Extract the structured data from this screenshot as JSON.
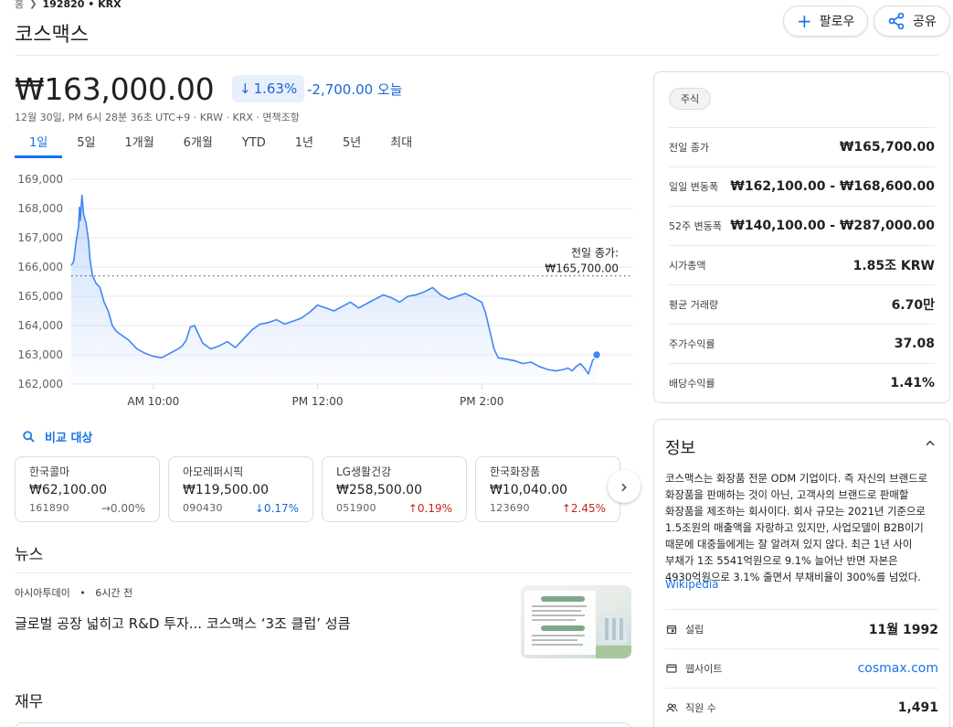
{
  "breadcrumb": {
    "home": "홈",
    "ticker": "192820 • KRX"
  },
  "title": "코스맥스",
  "actions": {
    "follow": "팔로우",
    "share": "공유"
  },
  "quote": {
    "price": "₩163,000.00",
    "change_pct": "1.63%",
    "change_abs": "-2,700.00 오늘",
    "meta": "12월 30일, PM 6시 28분 36초 UTC+9 · KRW · KRX · 면책조항"
  },
  "ranges": [
    "1일",
    "5일",
    "1개월",
    "6개월",
    "YTD",
    "1년",
    "5년",
    "최대"
  ],
  "active_range": "1일",
  "chart_data": {
    "type": "line",
    "y_ticks": [
      "169,000",
      "168,000",
      "167,000",
      "166,000",
      "165,000",
      "164,000",
      "163,000",
      "162,000"
    ],
    "x_ticks": [
      "AM 10:00",
      "PM 12:00",
      "PM 2:00"
    ],
    "ylim": [
      162000,
      169000
    ],
    "x_range_hours": [
      9.0,
      15.5
    ],
    "prev_close": 165700,
    "prev_close_label": [
      "전일 종가:",
      "₩165,700.00"
    ],
    "line_color": "#4285f4",
    "points": [
      [
        9.0,
        166050
      ],
      [
        9.03,
        166200
      ],
      [
        9.06,
        166900
      ],
      [
        9.09,
        167400
      ],
      [
        9.1,
        168050
      ],
      [
        9.11,
        167600
      ],
      [
        9.13,
        168450
      ],
      [
        9.15,
        167800
      ],
      [
        9.18,
        167500
      ],
      [
        9.21,
        166900
      ],
      [
        9.23,
        166200
      ],
      [
        9.26,
        165700
      ],
      [
        9.3,
        165450
      ],
      [
        9.35,
        165300
      ],
      [
        9.4,
        164800
      ],
      [
        9.45,
        164500
      ],
      [
        9.5,
        164000
      ],
      [
        9.55,
        163800
      ],
      [
        9.6,
        163700
      ],
      [
        9.7,
        163500
      ],
      [
        9.8,
        163200
      ],
      [
        9.9,
        163050
      ],
      [
        10.0,
        162950
      ],
      [
        10.1,
        162900
      ],
      [
        10.2,
        163050
      ],
      [
        10.3,
        163200
      ],
      [
        10.35,
        163300
      ],
      [
        10.4,
        163500
      ],
      [
        10.45,
        163950
      ],
      [
        10.5,
        164000
      ],
      [
        10.55,
        163700
      ],
      [
        10.6,
        163400
      ],
      [
        10.7,
        163200
      ],
      [
        10.8,
        163300
      ],
      [
        10.9,
        163450
      ],
      [
        11.0,
        163250
      ],
      [
        11.1,
        163550
      ],
      [
        11.2,
        163850
      ],
      [
        11.3,
        164050
      ],
      [
        11.4,
        164100
      ],
      [
        11.5,
        164200
      ],
      [
        11.6,
        164050
      ],
      [
        11.7,
        164150
      ],
      [
        11.8,
        164250
      ],
      [
        11.9,
        164450
      ],
      [
        12.0,
        164700
      ],
      [
        12.1,
        164600
      ],
      [
        12.2,
        164500
      ],
      [
        12.3,
        164650
      ],
      [
        12.4,
        164800
      ],
      [
        12.5,
        164600
      ],
      [
        12.6,
        164750
      ],
      [
        12.7,
        164900
      ],
      [
        12.8,
        165050
      ],
      [
        12.9,
        164950
      ],
      [
        13.0,
        164800
      ],
      [
        13.1,
        165000
      ],
      [
        13.2,
        165050
      ],
      [
        13.3,
        165150
      ],
      [
        13.4,
        165300
      ],
      [
        13.5,
        165050
      ],
      [
        13.6,
        164900
      ],
      [
        13.7,
        165000
      ],
      [
        13.8,
        165100
      ],
      [
        13.9,
        164950
      ],
      [
        14.0,
        164800
      ],
      [
        14.05,
        164400
      ],
      [
        14.1,
        163800
      ],
      [
        14.15,
        163200
      ],
      [
        14.2,
        162900
      ],
      [
        14.3,
        162850
      ],
      [
        14.4,
        162800
      ],
      [
        14.5,
        162700
      ],
      [
        14.6,
        162750
      ],
      [
        14.7,
        162600
      ],
      [
        14.8,
        162500
      ],
      [
        14.9,
        162450
      ],
      [
        15.0,
        162500
      ],
      [
        15.05,
        162550
      ],
      [
        15.1,
        162450
      ],
      [
        15.15,
        162600
      ],
      [
        15.2,
        162700
      ],
      [
        15.25,
        162550
      ],
      [
        15.3,
        162350
      ],
      [
        15.35,
        162800
      ],
      [
        15.4,
        163000
      ]
    ]
  },
  "compare": {
    "label": "비교 대상"
  },
  "peers": [
    {
      "name": "한국콜마",
      "price": "₩62,100.00",
      "code": "161890",
      "change": "→0.00%",
      "dir": "flat"
    },
    {
      "name": "아모레퍼시픽",
      "price": "₩119,500.00",
      "code": "090430",
      "change": "↓0.17%",
      "dir": "down"
    },
    {
      "name": "LG생활건강",
      "price": "₩258,500.00",
      "code": "051900",
      "change": "↑0.19%",
      "dir": "up"
    },
    {
      "name": "한국화장품",
      "price": "₩10,040.00",
      "code": "123690",
      "change": "↑2.45%",
      "dir": "up"
    }
  ],
  "news": {
    "section_title": "뉴스",
    "source": "아시아투데이",
    "dot": "•",
    "time": "6시간 전",
    "headline": "글로벌 공장 넓히고 R&D 투자... 코스맥스 ‘3조 클럽’ 성큼"
  },
  "finance": {
    "section_title": "재무"
  },
  "stats": {
    "chip": "주식",
    "rows": [
      {
        "label": "전일 종가",
        "value": "₩165,700.00"
      },
      {
        "label": "일일 변동폭",
        "value": "₩162,100.00 - ₩168,600.00"
      },
      {
        "label": "52주 변동폭",
        "value": "₩140,100.00 - ₩287,000.00"
      },
      {
        "label": "시가총액",
        "value": "1.85조 KRW"
      },
      {
        "label": "평균 거래량",
        "value": "6.70만"
      },
      {
        "label": "주가수익률",
        "value": "37.08"
      },
      {
        "label": "배당수익률",
        "value": "1.41%"
      }
    ]
  },
  "about": {
    "title": "정보",
    "description": "코스맥스는 화장품 전문 ODM 기업이다. 즉 자신의 브랜드로 화장품을 판매하는 것이 아닌, 고객사의 브랜드로 판매할 화장품을 제조하는 회사이다. 회사 규모는 2021년 기준으로 1.5조원의 매출액을 자랑하고 있지만, 사업모델이 B2B이기 때문에 대중들에게는 잘 알려져 있지 않다. 최근 1년 사이 부채가 1조 5541억원으로 9.1% 늘어난 반면 자본은 4930억원으로 3.1% 줄면서 부채비율이 300%를 넘었다.",
    "source": "Wikipedia",
    "rows": [
      {
        "label": "설립",
        "value": "11월 1992",
        "icon": "calendar-icon"
      },
      {
        "label": "웹사이트",
        "value": "cosmax.com",
        "icon": "browser-icon"
      },
      {
        "label": "직원 수",
        "value": "1,491",
        "icon": "people-icon"
      }
    ]
  }
}
